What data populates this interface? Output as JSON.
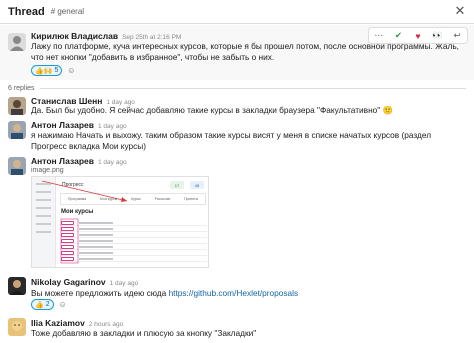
{
  "header": {
    "title": "Thread",
    "channel": "# general",
    "close_icon": "close-icon"
  },
  "toolbar": {
    "items": [
      "more-icon",
      "check-mark-icon",
      "heart-icon",
      "eyes-icon",
      "reply-icon"
    ]
  },
  "parent_message": {
    "author": "Кирилюк Владислав",
    "time": "Sep 25th at 2:16 PM",
    "text": "Лажу по платформе, куча интересных курсов, которые я бы прошел потом, после основной программы. Жаль, что нет кнопки \"добавить в избранное\", чтобы не забыть о них.",
    "reactions": [
      {
        "emoji": "👍",
        "emoji2": "🙌",
        "count": "5"
      }
    ],
    "add_reaction": "☺"
  },
  "replies": {
    "count_text": "6 replies"
  },
  "messages": [
    {
      "author": "Станислав Шенн",
      "time": "1 day ago",
      "text": "Да. Был бы удобно. Я сейчас добавляю такие курсы в закладки браузера \"Факультативно\" 🙂"
    },
    {
      "author": "Антон Лазарев",
      "time": "1 day ago",
      "text": "я нажимаю Начать и выхожу. таким образом такие курсы висят у меня в списке начатых курсов (раздел Прогресс вкладка Мои курсы)"
    },
    {
      "author": "Антон Лазарев",
      "time": "1 day ago",
      "file_name": "image.png",
      "screenshot": {
        "title": "Прогресс",
        "badge1": "17",
        "badge2": "45",
        "tabs": [
          "Программа",
          "Мои курсы",
          "Курсы",
          "Рассылки",
          "Проекты"
        ],
        "heading": "Мои курсы"
      }
    },
    {
      "author": "Nikolay Gagarinov",
      "time": "1 day ago",
      "text_prefix": "Вы можете предложить идею сюда ",
      "link": "https://github.com/Hexlet/proposals",
      "reactions": [
        {
          "emoji": "👍",
          "count": "2"
        }
      ],
      "add_reaction": "☺"
    },
    {
      "author": "Ilia Kaziamov",
      "time": "2 hours ago",
      "text": "Тоже добавляю в закладки и плюсую за кнопку \"Закладки\""
    }
  ],
  "colors": {
    "accent": "#1264a3",
    "reaction_border": "#1d9bd1",
    "highlight": "#d83a8a"
  }
}
